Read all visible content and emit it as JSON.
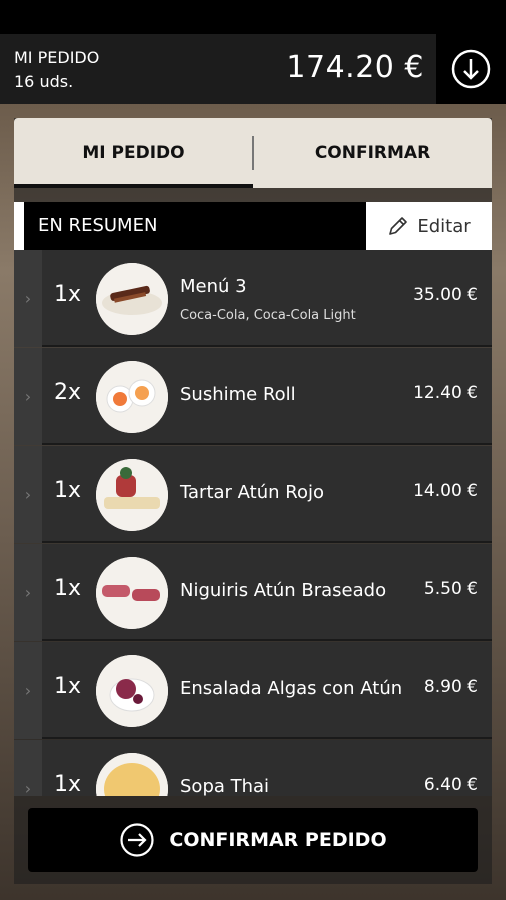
{
  "header": {
    "title": "MI PEDIDO",
    "units": "16 uds.",
    "total": "174.20 €",
    "download_icon": "arrow-down-circle-icon"
  },
  "tabs": [
    {
      "label": "MI PEDIDO",
      "active": true
    },
    {
      "label": "CONFIRMAR",
      "active": false
    }
  ],
  "summary": {
    "title": "EN RESUMEN",
    "edit_label": "Editar",
    "edit_icon": "pencil-icon"
  },
  "items": [
    {
      "qty": "1x",
      "name": "Menú 3",
      "subtitle": "Coca-Cola, Coca-Cola Light",
      "price": "35.00 €"
    },
    {
      "qty": "2x",
      "name": "Sushime Roll",
      "subtitle": "",
      "price": "12.40 €"
    },
    {
      "qty": "1x",
      "name": "Tartar Atún Rojo",
      "subtitle": "",
      "price": "14.00 €"
    },
    {
      "qty": "1x",
      "name": "Niguiris Atún Braseado",
      "subtitle": "",
      "price": "5.50 €"
    },
    {
      "qty": "1x",
      "name": "Ensalada Algas con Atún",
      "subtitle": "",
      "price": "8.90 €"
    },
    {
      "qty": "1x",
      "name": "Sopa Thai",
      "subtitle": "",
      "price": "6.40 €"
    }
  ],
  "confirm": {
    "label": "CONFIRMAR PEDIDO",
    "icon": "arrow-right-circle-icon"
  }
}
